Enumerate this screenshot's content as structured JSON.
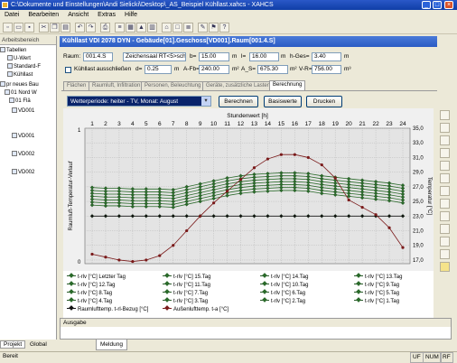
{
  "window": {
    "title": "C:\\Dokumente und Einstellungen\\Andi Sielicki\\Desktop\\_AS_Beispiel Kühllast.xahcs - XAHCS"
  },
  "menu": [
    "Datei",
    "Bearbeiten",
    "Ansicht",
    "Extras",
    "Hilfe"
  ],
  "left_panel": {
    "title": "Arbeitsbereich",
    "tree": [
      "Tabellen",
      "U-Wert",
      "Standard-F",
      "Kühllast",
      "pr neues Bau",
      "01 Nord W",
      "01 Flä",
      "VD001",
      "VD001",
      "VD002",
      "VD002"
    ],
    "tabs": [
      "Projekt",
      "Global"
    ]
  },
  "content_title": "Kühllast VDI 2078 DYN - Gebäude[01].Geschoss[VD001].Raum[001.4.S]",
  "form": {
    "raum_label": "Raum:",
    "raum_value": "001.4.S",
    "zeichensaal_value": "Zeichensaal RT<5>sch",
    "b_label": "b=",
    "b_value": "15.00",
    "b_unit": "m",
    "l_label": "l=",
    "l_value": "16.00",
    "l_unit": "m",
    "hges_label": "h-Ges=",
    "hges_value": "3.40",
    "hges_unit": "m",
    "kuehl_label": "Kühllast ausschließen",
    "d_label": "d=",
    "d_value": "0.25",
    "d_unit": "m",
    "afb_label": "A-Fb=",
    "afb_value": "240.00",
    "afb_unit": "m²",
    "as_label": "A_S=",
    "as_value": "675.30",
    "as_unit": "m²",
    "vr_label": "V-R=",
    "vr_value": "756.00",
    "vr_unit": "m³"
  },
  "tabs": [
    "Flächen",
    "Raumluft, Infiltration",
    "Personen, Beleuchtung",
    "Geräte, zusätzliche Lasten",
    "Berechnung"
  ],
  "period_select": "Wetterperiode: heiter - TV, Monat: August",
  "buttons": {
    "berechnen": "Berechnen",
    "basiswerte": "Basiswerte",
    "drucken": "Drucken"
  },
  "chart_data": {
    "type": "line",
    "x_title": "Stundenwert [h]",
    "y_left_title": "Raumluft-Temperatur-Verlauf",
    "y_right_title": "Temperatur [°C]",
    "x": [
      1,
      2,
      3,
      4,
      5,
      6,
      7,
      8,
      9,
      10,
      11,
      12,
      13,
      14,
      15,
      16,
      17,
      18,
      19,
      20,
      21,
      22,
      23,
      24
    ],
    "x_ticks": [
      "1",
      "2",
      "3",
      "4",
      "5",
      "6",
      "7",
      "8",
      "9",
      "10",
      "11",
      "12",
      "13",
      "14",
      "15",
      "16",
      "17",
      "18",
      "19",
      "20",
      "21",
      "22",
      "23",
      "24"
    ],
    "y_ticks_left": [
      "0",
      "1"
    ],
    "y_ticks_right": [
      "35,0",
      "33,0",
      "31,0",
      "29,0",
      "27,0",
      "25,0",
      "23,0",
      "21,0",
      "19,0",
      "17,0"
    ],
    "ylim": [
      16.5,
      35.0
    ],
    "series": [
      {
        "name": "t-rlv [°C] Letzter Tag",
        "color": "#2a6a2a",
        "values": [
          26.9,
          26.8,
          26.8,
          26.7,
          26.7,
          26.7,
          26.6,
          27.0,
          27.4,
          27.8,
          28.2,
          28.5,
          28.7,
          28.8,
          28.9,
          28.9,
          28.8,
          28.5,
          28.3,
          28.1,
          27.9,
          27.7,
          27.5,
          27.2
        ]
      },
      {
        "name": "t-rlv [°C] 15.Tag",
        "color": "#2a6a2a",
        "values": [
          26.5,
          26.4,
          26.4,
          26.3,
          26.3,
          26.3,
          26.2,
          26.6,
          27.0,
          27.4,
          27.8,
          28.1,
          28.3,
          28.4,
          28.5,
          28.5,
          28.4,
          28.1,
          27.9,
          27.7,
          27.5,
          27.3,
          27.1,
          26.8
        ]
      },
      {
        "name": "t-rlv [°C] 14.Tag",
        "color": "#2a6a2a",
        "values": [
          26.1,
          26.0,
          26.0,
          25.9,
          25.9,
          25.9,
          25.8,
          26.2,
          26.6,
          27.0,
          27.4,
          27.7,
          27.9,
          28.0,
          28.1,
          28.1,
          28.0,
          27.7,
          27.5,
          27.3,
          27.1,
          26.9,
          26.7,
          26.4
        ]
      },
      {
        "name": "t-rlv [°C] 13.Tag",
        "color": "#2a6a2a",
        "values": [
          25.7,
          25.6,
          25.6,
          25.5,
          25.5,
          25.5,
          25.4,
          25.8,
          26.2,
          26.6,
          27.0,
          27.3,
          27.5,
          27.6,
          27.7,
          27.7,
          27.6,
          27.3,
          27.1,
          26.9,
          26.7,
          26.5,
          26.3,
          26.0
        ]
      },
      {
        "name": "t-rlv [°C] 12.Tag",
        "color": "#2a6a2a",
        "values": [
          25.3,
          25.2,
          25.2,
          25.1,
          25.1,
          25.1,
          25.0,
          25.4,
          25.8,
          26.2,
          26.6,
          26.9,
          27.1,
          27.2,
          27.3,
          27.3,
          27.2,
          26.9,
          26.7,
          26.5,
          26.3,
          26.1,
          25.9,
          25.6
        ]
      },
      {
        "name": "t-rlv [°C] 11.Tag",
        "color": "#2a6a2a",
        "values": [
          24.9,
          24.8,
          24.8,
          24.7,
          24.7,
          24.7,
          24.6,
          25.0,
          25.4,
          25.8,
          26.2,
          26.5,
          26.7,
          26.8,
          26.9,
          26.9,
          26.8,
          26.5,
          26.3,
          26.1,
          25.9,
          25.7,
          25.5,
          25.2
        ]
      },
      {
        "name": "t-rlv [°C] 10.Tag",
        "color": "#2a6a2a",
        "values": [
          24.5,
          24.4,
          24.4,
          24.3,
          24.3,
          24.3,
          24.2,
          24.6,
          25.0,
          25.4,
          25.8,
          26.1,
          26.3,
          26.4,
          26.5,
          26.5,
          26.4,
          26.1,
          25.9,
          25.7,
          25.5,
          25.3,
          25.1,
          24.8
        ]
      },
      {
        "name": "t-rlv [°C] 8.Tag",
        "color": "#2a6a2a",
        "values": []
      },
      {
        "name": "t-rlv [°C] 7.Tag",
        "color": "#2a6a2a",
        "values": []
      },
      {
        "name": "t-rlv [°C] 6.Tag",
        "color": "#2a6a2a",
        "values": []
      },
      {
        "name": "t-rlv [°C] 5.Tag",
        "color": "#2a6a2a",
        "values": []
      },
      {
        "name": "t-rlv [°C] 4.Tag",
        "color": "#2a6a2a",
        "values": []
      },
      {
        "name": "t-rlv [°C] 3.Tag",
        "color": "#2a6a2a",
        "values": []
      },
      {
        "name": "t-rlv [°C] 2.Tag",
        "color": "#2a6a2a",
        "values": []
      },
      {
        "name": "t-rlv [°C] 1.Tag",
        "color": "#2a6a2a",
        "values": []
      },
      {
        "name": "Raumlufttemp. t-rl-Bezug [°C]",
        "color": "#111111",
        "values": [
          23.0,
          23.0,
          23.0,
          23.0,
          23.0,
          23.0,
          23.0,
          23.0,
          23.0,
          23.0,
          23.0,
          23.0,
          23.0,
          23.0,
          23.0,
          23.0,
          23.0,
          23.0,
          23.0,
          23.0,
          23.0,
          23.0,
          23.0,
          23.0
        ]
      },
      {
        "name": "Außenlufttemp. t-a [°C]",
        "color": "#7a1a1a",
        "values": [
          17.8,
          17.4,
          17.0,
          16.8,
          17.0,
          17.6,
          19.0,
          21.0,
          23.0,
          24.8,
          26.4,
          28.0,
          29.6,
          30.8,
          31.4,
          31.4,
          31.0,
          30.0,
          28.2,
          25.2,
          24.2,
          23.2,
          21.4,
          18.7
        ]
      }
    ],
    "grid": true
  },
  "legend_rows": [
    [
      "t-rlv [°C] Letzter Tag",
      "t-rlv [°C] 15.Tag",
      "t-rlv [°C] 14.Tag",
      "t-rlv [°C] 13.Tag"
    ],
    [
      "t-rlv [°C] 12.Tag",
      "t-rlv [°C] 11.Tag",
      "t-rlv [°C] 10.Tag",
      "t-rlv [°C] 9.Tag"
    ],
    [
      "t-rlv [°C] 8.Tag",
      "t-rlv [°C] 7.Tag",
      "t-rlv [°C] 6.Tag",
      "t-rlv [°C] 5.Tag"
    ],
    [
      "t-rlv [°C] 4.Tag",
      "t-rlv [°C] 3.Tag",
      "t-rlv [°C] 2.Tag",
      "t-rlv [°C] 1.Tag"
    ],
    [
      "Raumlufttemp. t-rl-Bezug [°C]",
      "Außenlufttemp. t-a [°C]"
    ]
  ],
  "output": {
    "title": "Ausgabe",
    "tab": "Meldung"
  },
  "status": {
    "left": "Bereit",
    "right": [
      "UF",
      "NUM",
      "RF"
    ]
  }
}
